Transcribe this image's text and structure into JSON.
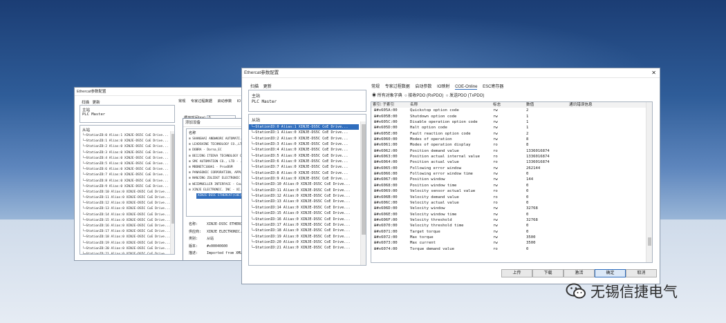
{
  "left_window": {
    "title": "Ethercat参数配置",
    "menu": [
      "扫描",
      "更新"
    ],
    "master_header": "主站",
    "master": "PLC Master",
    "slave_header": "从站",
    "slaves": [
      "StationID:0  Alias:1  XINJE-DS5C CoE Drive...",
      "StationID:1  Alias:0  XINJE-DS5C CoE Drive...",
      "StationID:2  Alias:0  XINJE-DS5C CoE Drive...",
      "StationID:3  Alias:0  XINJE-DS5C CoE Drive...",
      "StationID:4  Alias:0  XINJE-DS5C CoE Drive...",
      "StationID:5  Alias:0  XINJE-DS5C CoE Drive...",
      "StationID:6  Alias:0  XINJE-DS5C CoE Drive...",
      "StationID:7  Alias:0  XINJE-DS5C CoE Drive...",
      "StationID:8  Alias:0  XINJE-DS5C CoE Drive...",
      "StationID:9  Alias:0  XINJE-DS5C CoE Drive...",
      "StationID:10  Alias:0  XINJE-DS5C CoE Drive...",
      "StationID:11  Alias:0  XINJE-DS5C CoE Drive...",
      "StationID:12  Alias:0  XINJE-DS5C CoE Drive...",
      "StationID:13  Alias:0  XINJE-DS5C CoE Drive...",
      "StationID:14  Alias:0  XINJE-DS5C CoE Drive...",
      "StationID:15  Alias:0  XINJE-DS5C CoE Drive...",
      "StationID:16  Alias:0  XINJE-DS5C CoE Drive...",
      "StationID:17  Alias:0  XINJE-DS5C CoE Drive...",
      "StationID:18  Alias:0  XINJE-DS5C CoE Drive...",
      "StationID:19  Alias:0  XINJE-DS5C CoE Drive...",
      "StationID:20  Alias:0  XINJE-DS5C CoE Drive...",
      "StationID:21  Alias:0  XINJE-DS5C CoE Drive..."
    ],
    "tabs": [
      "常规",
      "专家过程数据",
      "启动参数",
      "IO"
    ],
    "cycle_label": "循环时间(ms)",
    "cycle_value": "0"
  },
  "add_device": {
    "title": "添加设备",
    "col": "名称",
    "vendors": [
      "SHANGHAI ANDWKORC  AUTOMATI...",
      "LEADSHINE TECHNOLOGY CO.,LTD",
      "DOBRA - Dorna_EC",
      "BEIJING ITEDVA TECHNOLOGY C...",
      "SMC AUTOMATION CO., LTD - ...",
      "MBDNETC100A1 - ProxBSM",
      "PANASONIC CORPORATION, APPLI...",
      "NANJING ZOLIDGT ELECTRONIC ...",
      "WEIDMUELLER INTERFACE - Coup...",
      "XINJE ELECTRONIC. INC - XI..."
    ],
    "selected": "XINJE-DS5C ETHERCAT(COE)",
    "info": [
      {
        "k": "名称:",
        "v": "XINJE-DS5C ETHERCA..."
      },
      {
        "k": "供应商:",
        "v": "XINJE ELECTRONIC..."
      },
      {
        "k": "类别:",
        "v": "从站"
      },
      {
        "k": "版本:",
        "v": "#x00040600"
      },
      {
        "k": "描述:",
        "v": "Imported from XML..."
      }
    ]
  },
  "main_window": {
    "title": "Ethercat参数配置",
    "close": "✕",
    "menu": [
      "扫描",
      "更新"
    ],
    "master_header": "主站",
    "master": "PLC Master",
    "slave_header": "从站",
    "slaves": [
      "StationID:0  Alias:1  XINJE-DS5C CoE Drive...",
      "StationID:1  Alias:0  XINJE-DS5C CoE Drive...",
      "StationID:2  Alias:0  XINJE-DS5C CoE Drive...",
      "StationID:3  Alias:0  XINJE-DS5C CoE Drive...",
      "StationID:4  Alias:0  XINJE-DS5C CoE Drive...",
      "StationID:5  Alias:0  XINJE-DS5C CoE Drive...",
      "StationID:6  Alias:0  XINJE-DS5C CoE Drive...",
      "StationID:7  Alias:0  XINJE-DS5C CoE Drive...",
      "StationID:8  Alias:0  XINJE-DS5C CoE Drive...",
      "StationID:9  Alias:0  XINJE-DS5C CoE Drive...",
      "StationID:10  Alias:0  XINJE-DS5C CoE Drive...",
      "StationID:11  Alias:0  XINJE-DS5C CoE Drive...",
      "StationID:12  Alias:0  XINJE-DS5C CoE Drive...",
      "StationID:13  Alias:0  XINJE-DS5C CoE Drive...",
      "StationID:14  Alias:0  XINJE-DS5C CoE Drive...",
      "StationID:15  Alias:0  XINJE-DS5C CoE Drive...",
      "StationID:16  Alias:0  XINJE-DS5C CoE Drive...",
      "StationID:17  Alias:0  XINJE-DS5C CoE Drive...",
      "StationID:18  Alias:0  XINJE-DS5C CoE Drive...",
      "StationID:19  Alias:0  XINJE-DS5C CoE Drive...",
      "StationID:20  Alias:0  XINJE-DS5C CoE Drive...",
      "StationID:21  Alias:0  XINJE-DS5C CoE Drive..."
    ],
    "tabs": [
      "常规",
      "专家过程数据",
      "启动参数",
      "IO映射",
      "COE-Online",
      "ESC寄存器"
    ],
    "radios": [
      "所有对象字典",
      "接收PDO (RxPDO)",
      "发送PDO (TxPDO)"
    ],
    "columns": [
      "索引: 子索引",
      "名称",
      "标志",
      "数值",
      "通讯错误信息"
    ],
    "rows": [
      [
        "#x605A:00",
        "Quickstop option code",
        "rw",
        "2"
      ],
      [
        "#x605B:00",
        "Shutdown option code",
        "rw",
        "1"
      ],
      [
        "#x605C:00",
        "Disable operation option code",
        "rw",
        "1"
      ],
      [
        "#x605D:00",
        "Halt option code",
        "rw",
        "1"
      ],
      [
        "#x605E:00",
        "Fault reaction option code",
        "rw",
        "2"
      ],
      [
        "#x6060:00",
        "Modes of operation",
        "rw",
        "8"
      ],
      [
        "#x6061:00",
        "Modes of operation display",
        "ro",
        "8"
      ],
      [
        "#x6062:00",
        "Position demand value",
        "ro",
        "1336016874"
      ],
      [
        "#x6063:00",
        "Position actual internal value",
        "ro",
        "1336016874"
      ],
      [
        "#x6064:00",
        "Position actual value",
        "ro",
        "1336016874"
      ],
      [
        "#x6065:00",
        "Following error window",
        "rw",
        "262144"
      ],
      [
        "#x6066:00",
        "Following error window time",
        "rw",
        "0"
      ],
      [
        "#x6067:00",
        "Position window",
        "rw",
        "144"
      ],
      [
        "#x6068:00",
        "Position window time",
        "rw",
        "0"
      ],
      [
        "#x6069:00",
        "Velocity sensor actual value",
        "ro",
        "0"
      ],
      [
        "#x606B:00",
        "Velocity demand value",
        "ro",
        "0"
      ],
      [
        "#x606C:00",
        "Velocity actual value",
        "ro",
        "0"
      ],
      [
        "#x606D:00",
        "Velocity window",
        "rw",
        "32768"
      ],
      [
        "#x606E:00",
        "Velocity window time",
        "rw",
        "0"
      ],
      [
        "#x606F:00",
        "Velocity threshold",
        "rw",
        "32768"
      ],
      [
        "#x6070:00",
        "Velocity threshold time",
        "rw",
        "0"
      ],
      [
        "#x6071:00",
        "Target torque",
        "rw",
        "0"
      ],
      [
        "#x6072:00",
        "Max torque",
        "rw",
        "3500"
      ],
      [
        "#x6073:00",
        "Max current",
        "rw",
        "3500"
      ],
      [
        "#x6074:00",
        "Torque demand value",
        "ro",
        "0"
      ]
    ],
    "buttons": {
      "up": "上传",
      "down": "下载",
      "activate": "激活",
      "ok": "确定",
      "cancel": "取消"
    }
  },
  "watermark": {
    "text": "无锡信捷电气"
  },
  "colors": {
    "selection": "#2f6dbd",
    "bg_top": "#1b3d74"
  }
}
